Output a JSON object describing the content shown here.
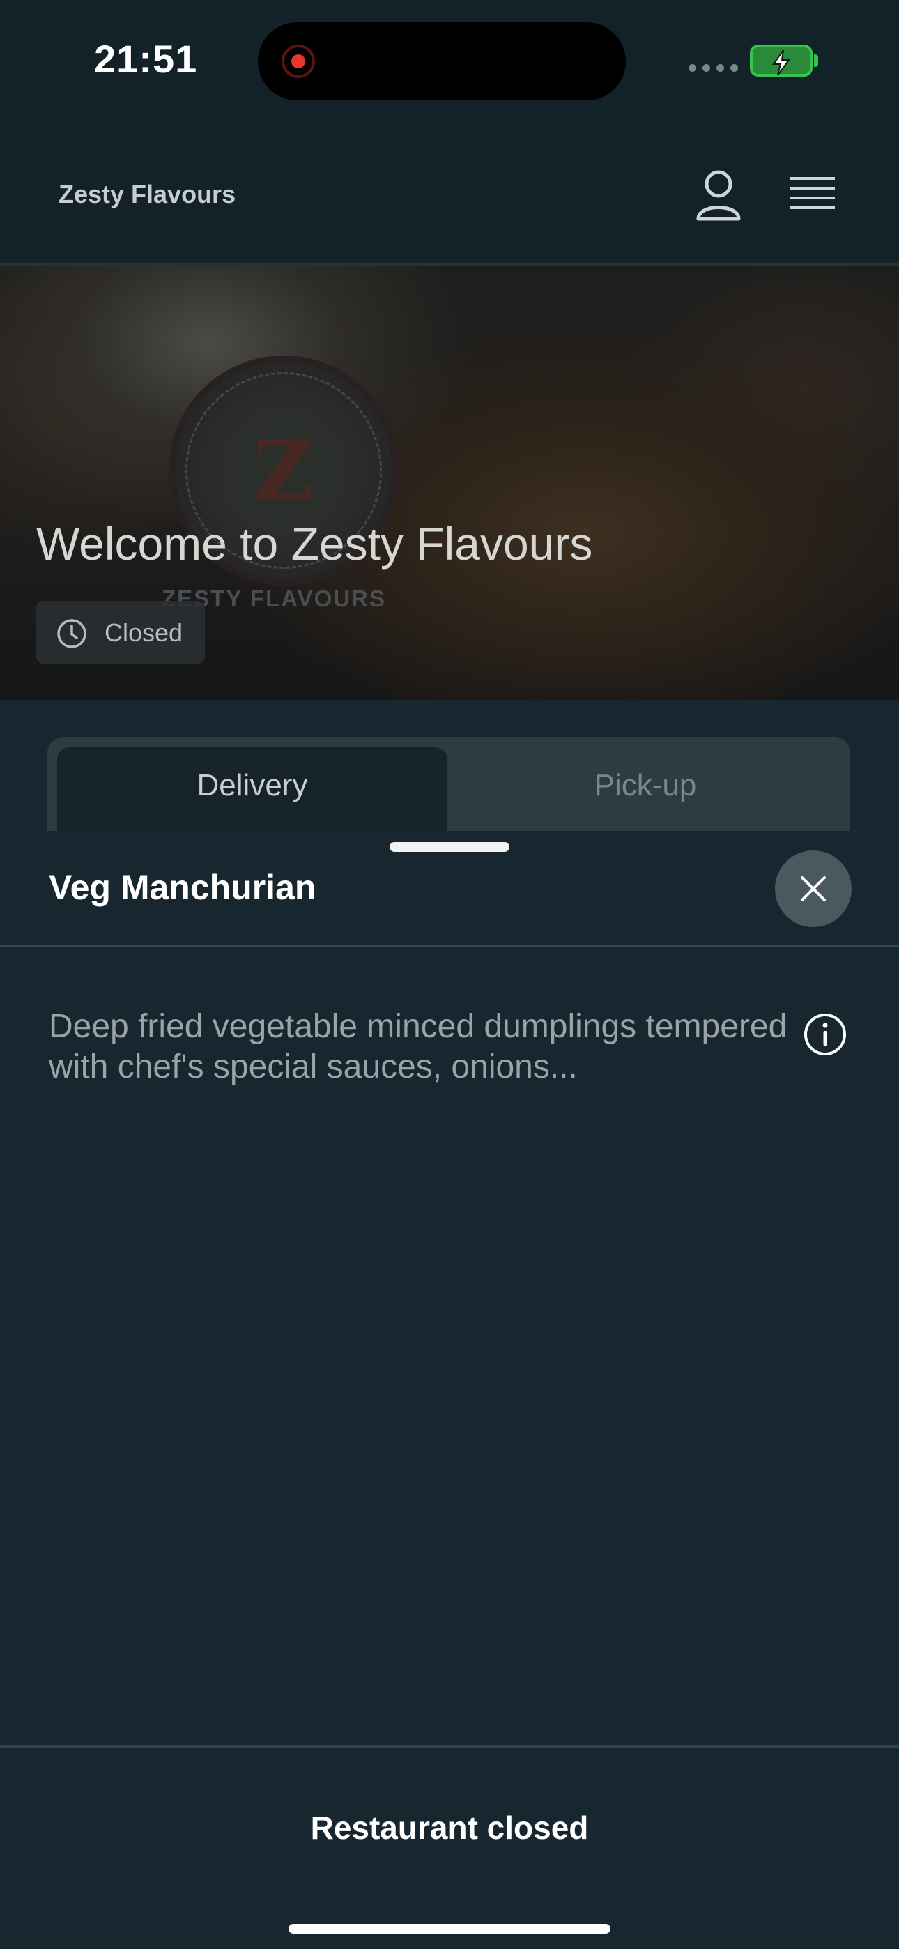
{
  "status_bar": {
    "time": "21:51"
  },
  "header": {
    "brand": "Zesty Flavours",
    "icons": [
      "user-icon",
      "menu-icon"
    ]
  },
  "hero": {
    "title": "Welcome to Zesty Flavours",
    "logo_text": "ZESTY FLAVOURS",
    "logo_letter": "Z",
    "status": "Closed",
    "status_icon": "clock-icon"
  },
  "tabs": [
    {
      "label": "Delivery",
      "active": true
    },
    {
      "label": "Pick-up",
      "active": false
    }
  ],
  "sheet": {
    "title": "Veg Manchurian",
    "description": "Deep fried vegetable minced dumplings tempered with chef's special sauces, onions...",
    "close_icon": "close-icon",
    "info_icon": "info-icon"
  },
  "footer": {
    "button_label": "Restaurant closed"
  },
  "colors": {
    "background": "#17262f",
    "battery": "#36c24e",
    "record": "#e5392d"
  }
}
